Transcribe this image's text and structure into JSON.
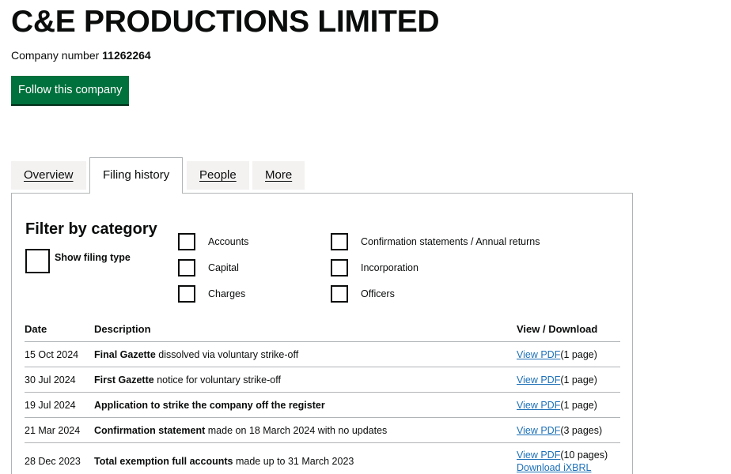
{
  "company": {
    "name": "C&E PRODUCTIONS LIMITED",
    "number_label": "Company number",
    "number": "11262264",
    "follow_label": "Follow this company"
  },
  "tabs": [
    {
      "label": "Overview",
      "active": false
    },
    {
      "label": "Filing history",
      "active": true
    },
    {
      "label": "People",
      "active": false
    },
    {
      "label": "More",
      "active": false
    }
  ],
  "filter": {
    "heading": "Filter by category",
    "show_filing_type": "Show filing type",
    "categories": [
      {
        "label": "Accounts",
        "checked": false
      },
      {
        "label": "Capital",
        "checked": false
      },
      {
        "label": "Charges",
        "checked": false
      },
      {
        "label": "Confirmation statements / Annual returns",
        "checked": false
      },
      {
        "label": "Incorporation",
        "checked": false
      },
      {
        "label": "Officers",
        "checked": false
      }
    ]
  },
  "table": {
    "headers": {
      "date": "Date",
      "description": "Description",
      "view": "View / Download"
    },
    "rows": [
      {
        "date": "15 Oct 2024",
        "bold": "Final Gazette",
        "rest": " dissolved via voluntary strike-off",
        "view": "View PDF",
        "pages": "(1 page)"
      },
      {
        "date": "30 Jul 2024",
        "bold": "First Gazette",
        "rest": " notice for voluntary strike-off",
        "view": "View PDF",
        "pages": "(1 page)"
      },
      {
        "date": "19 Jul 2024",
        "bold": "Application to strike the company off the register",
        "rest": "",
        "view": "View PDF",
        "pages": "(1 page)"
      },
      {
        "date": "21 Mar 2024",
        "bold": "Confirmation statement",
        "rest": " made on 18 March 2024 with no updates",
        "view": "View PDF",
        "pages": "(3 pages)"
      },
      {
        "date": "28 Dec 2023",
        "bold": "Total exemption full accounts",
        "rest": " made up to 31 March 2023",
        "view": "View PDF",
        "pages": "(10 pages)",
        "extra_link": "Download iXBRL"
      }
    ]
  },
  "colors": {
    "button_green": "#00703c",
    "link_blue": "#1d70b8",
    "text": "#0b0c0c",
    "border": "#b1b4b6",
    "tab_bg": "#f3f2f1"
  }
}
